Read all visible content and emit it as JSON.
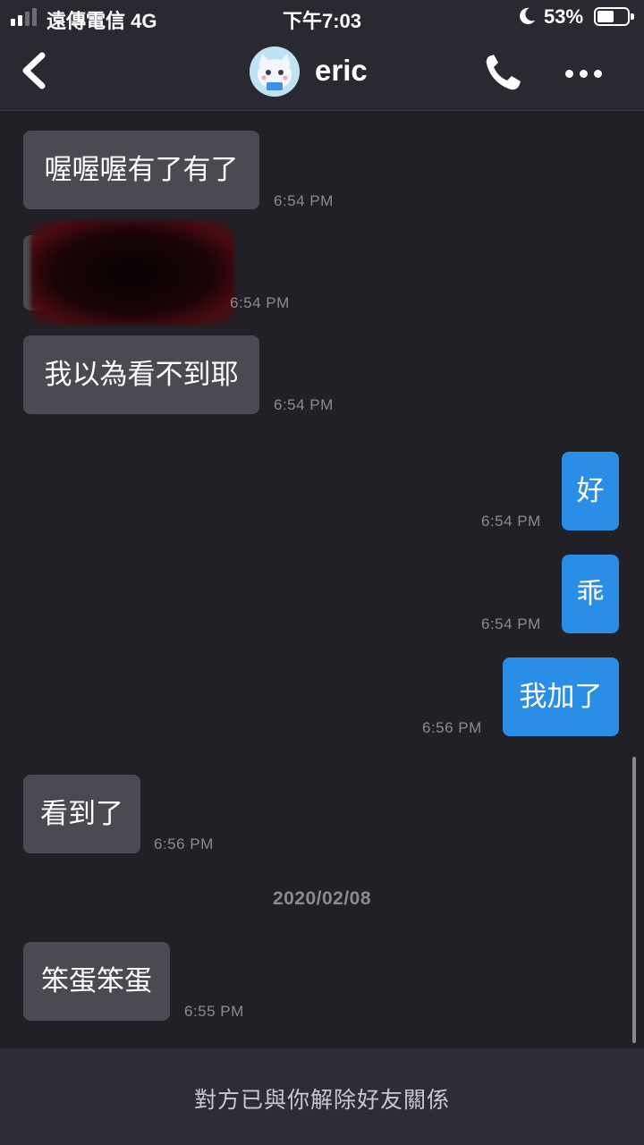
{
  "status_bar": {
    "carrier": "遠傳電信 4G",
    "time": "下午7:03",
    "battery_percent": "53%",
    "battery_level": 0.53,
    "signal_bars_active": 2,
    "icons": [
      "signal-icon",
      "moon-icon",
      "battery-icon"
    ]
  },
  "header": {
    "contact_name": "eric",
    "icons": [
      "back-icon",
      "avatar",
      "phone-icon",
      "more-icon"
    ]
  },
  "messages": [
    {
      "direction": "in",
      "text": "喔喔喔有了有了",
      "time": "6:54 PM"
    },
    {
      "direction": "in",
      "text": "",
      "redacted": true,
      "time": "6:54 PM"
    },
    {
      "direction": "in",
      "text": "我以為看不到耶",
      "time": "6:54 PM"
    },
    {
      "direction": "out",
      "text": "好",
      "time": "6:54 PM"
    },
    {
      "direction": "out",
      "text": "乖",
      "time": "6:54 PM"
    },
    {
      "direction": "out",
      "text": "我加了",
      "time": "6:56 PM"
    },
    {
      "direction": "in",
      "text": "看到了",
      "time": "6:56 PM"
    },
    {
      "direction": "in",
      "text": "笨蛋笨蛋",
      "time": "6:55 PM"
    }
  ],
  "date_separator": "2020/02/08",
  "footer": {
    "notice": "對方已與你解除好友關係"
  },
  "colors": {
    "background": "#212027",
    "bar": "#2a2931",
    "incoming_bubble": "#4b4a52",
    "outgoing_bubble": "#2b8ee6",
    "timestamp": "#8b8a92"
  }
}
